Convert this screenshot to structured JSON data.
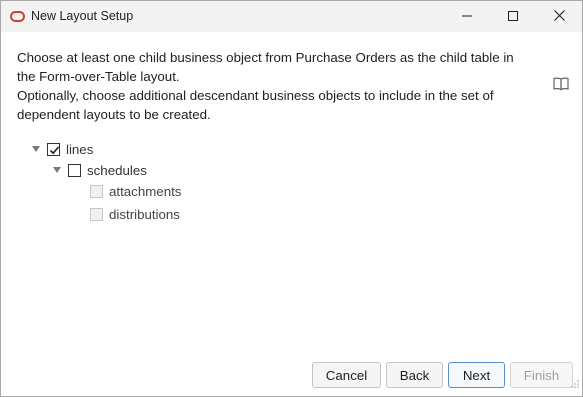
{
  "window": {
    "title": "New Layout Setup",
    "app_icon": "oracle-ring-icon",
    "controls": {
      "minimize": "minimize-icon",
      "maximize": "maximize-icon",
      "close": "close-icon"
    }
  },
  "instructions": {
    "line1": "Choose at least one child business object from Purchase Orders as the child table in",
    "line2": "the Form-over-Table layout.",
    "line3": "Optionally, choose additional descendant business objects to include in the set of",
    "line4": "dependent layouts to be created."
  },
  "help_icon": "book-icon",
  "tree": {
    "items": [
      {
        "label": "lines",
        "checked": true,
        "enabled": true,
        "expanded": true
      },
      {
        "label": "schedules",
        "checked": false,
        "enabled": true,
        "expanded": true
      },
      {
        "label": "attachments",
        "checked": false,
        "enabled": false
      },
      {
        "label": "distributions",
        "checked": false,
        "enabled": false
      }
    ]
  },
  "buttons": {
    "cancel": "Cancel",
    "back": "Back",
    "next": "Next",
    "finish": "Finish"
  },
  "colors": {
    "accent": "#c74634",
    "primary_border": "#5b8fc7"
  }
}
